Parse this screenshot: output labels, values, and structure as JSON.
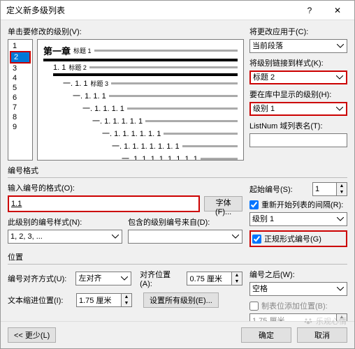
{
  "title": "定义新多级列表",
  "left": {
    "levelLabel": "单击要修改的级别(V):",
    "levels": [
      "1",
      "2",
      "3",
      "4",
      "5",
      "6",
      "7",
      "8",
      "9"
    ],
    "selected": "2"
  },
  "preview": {
    "l1": "第一章",
    "l1t": "标题 1",
    "l2": "1. 1",
    "l2t": "标题 2",
    "l3": "一. 1. 1",
    "l3t": "标题 3",
    "l4": "一. 1. 1. 1",
    "l5": "一. 1. 1. 1. 1",
    "l6": "一. 1. 1. 1. 1. 1",
    "l7": "一. 1. 1. 1. 1. 1. 1",
    "l8": "一. 1. 1. 1. 1. 1. 1. 1",
    "l9": "一. 1. 1. 1. 1. 1. 1. 1. 1"
  },
  "right": {
    "applyToLabel": "将更改应用于(C):",
    "applyTo": "当前段落",
    "linkStyleLabel": "将级别链接到样式(K):",
    "linkStyle": "标题 2",
    "galleryLabel": "要在库中显示的级别(H):",
    "gallery": "级别 1",
    "listNumLabel": "ListNum 域列表名(T):",
    "listNum": ""
  },
  "format": {
    "title": "编号格式",
    "enterLabel": "输入编号的格式(O):",
    "value": "1.1",
    "fontBtn": "字体(F)...",
    "styleLabel": "此级别的编号样式(N):",
    "style": "1, 2, 3, ...",
    "includeLabel": "包含的级别编号来自(D):",
    "include": "",
    "startLabel": "起始编号(S):",
    "start": "1",
    "restartLabel": "重新开始列表的间隔(R):",
    "restart": "级别 1",
    "legalLabel": "正规形式编号(G)"
  },
  "position": {
    "title": "位置",
    "alignLabel": "编号对齐方式(U):",
    "align": "左对齐",
    "alignAtLabel": "对齐位置(A):",
    "alignAt": "0.75 厘米",
    "indentLabel": "文本缩进位置(I):",
    "indent": "1.75 厘米",
    "setAllBtn": "设置所有级别(E)...",
    "followLabel": "编号之后(W):",
    "follow": "空格",
    "tabAddLabel": "制表位添加位置(B):",
    "tabAdd": "1.75 厘米"
  },
  "footer": {
    "less": "<< 更少(L)",
    "ok": "确定",
    "cancel": "取消"
  },
  "watermark": "乐观心情"
}
